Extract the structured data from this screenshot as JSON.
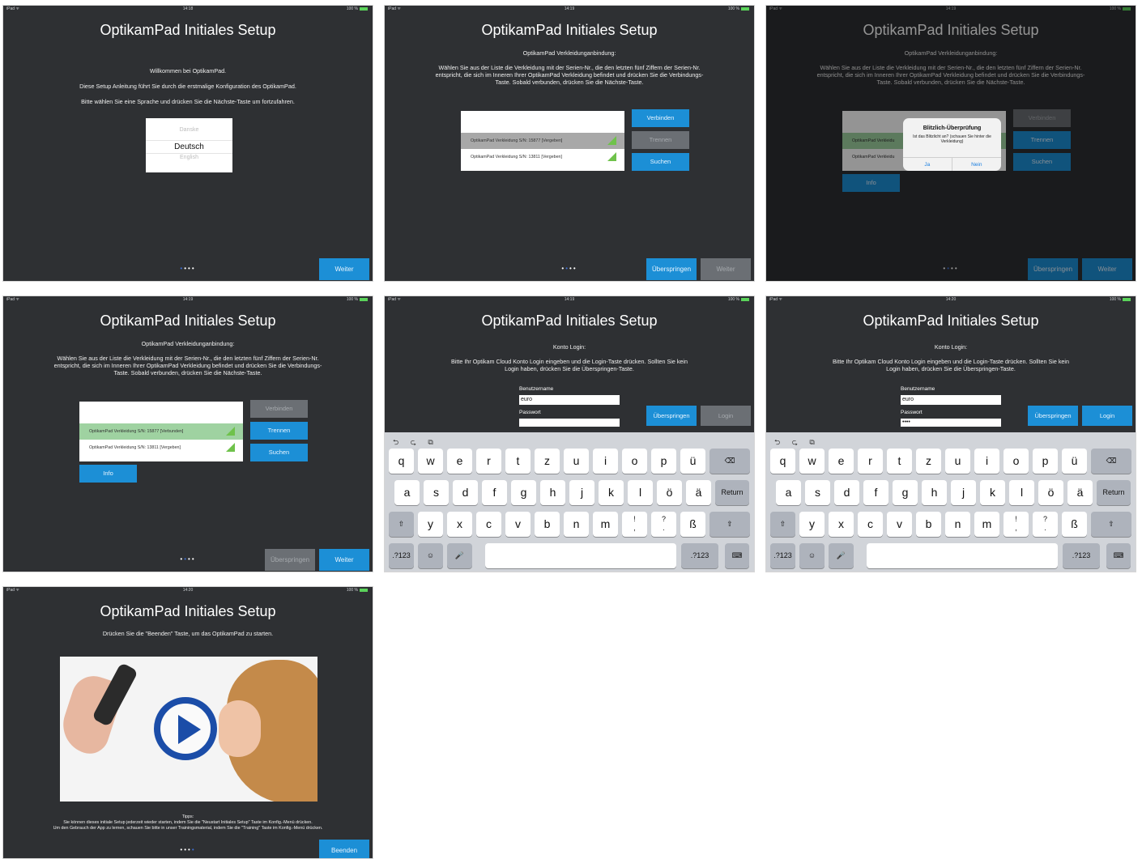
{
  "status": {
    "device": "iPad ᯤ",
    "battery": "100 %",
    "bt": "✱"
  },
  "title": "OptikamPad Initiales Setup",
  "screen1": {
    "time": "14:18",
    "welcome": "Willkommen bei OptikamPad.",
    "guide": "Diese Setup Anleitung führt Sie durch die erstmalige Konfiguration des OptikamPad.",
    "choose": "Bitte wählen Sie eine Sprache und drücken Sie  die Nächste-Taste um fortzufahren.",
    "languages": [
      "Danske",
      "Deutsch",
      "English"
    ],
    "next": "Weiter"
  },
  "pairing": {
    "heading": "OptikamPad Verkleidunganbindung:",
    "instr": "Wählen Sie aus der Liste die Verkleidung mit der Serien-Nr., die den letzten fünf Ziffern der Serien-Nr. entspricht, die sich im Inneren Ihrer OptikamPad Verkleidung befindet und drücken Sie die Verbindungs-Taste. Sobald verbunden, drücken Sie die Nächste-Taste.",
    "connect": "Verbinden",
    "disconnect": "Trennen",
    "search": "Suchen",
    "info": "Info",
    "skip": "Überspringen",
    "next": "Weiter",
    "item1": "OptikamPad Verkleidung S/N: 15877 [Vergeben]",
    "item1_connected": "OptikamPad Verkleidung S/N: 15877 [Verbunden]",
    "item2": "OptikamPad Verkleidung S/N: 13811 [Vergeben]",
    "item_short": "OptikamPad Verkleidu"
  },
  "screen2": {
    "time": "14:19"
  },
  "screen3": {
    "time": "14:19",
    "alert_title": "Blitzlich-Überprüfung",
    "alert_msg": "Ist das Blitzlicht an? (schauen Sie hinter die Verkleidung)",
    "yes": "Ja",
    "no": "Nein"
  },
  "screen4": {
    "time": "14:19"
  },
  "login": {
    "heading": "Konto Login:",
    "instr": "Bitte Ihr Optikam Cloud Konto Login eingeben und die Login-Taste drücken. Sollten Sie kein Login haben, drücken Sie die Überspringen-Taste.",
    "user_label": "Benutzername",
    "pass_label": "Passwort",
    "user_value": "euro",
    "pass_value": "••••",
    "skip": "Überspringen",
    "login": "Login"
  },
  "screen5": {
    "time": "14:19"
  },
  "screen6": {
    "time": "14:20"
  },
  "keyboard": {
    "tools": "⮌ ⮎ ⧉",
    "row1": [
      "q",
      "w",
      "e",
      "r",
      "t",
      "z",
      "u",
      "i",
      "o",
      "p",
      "ü"
    ],
    "row2": [
      "a",
      "s",
      "d",
      "f",
      "g",
      "h",
      "j",
      "k",
      "l",
      "ö",
      "ä"
    ],
    "row3": [
      "y",
      "x",
      "c",
      "v",
      "b",
      "n",
      "m",
      "!\n,",
      "?\n.",
      "ß"
    ],
    "backspace": "⌫",
    "return": "Return",
    "shift": "⇧",
    "num": ".?123",
    "emoji": "☺",
    "mic": "🎤",
    "hide": "⌨"
  },
  "screen7": {
    "time": "14:20",
    "start": "Drücken Sie die \"Beenden\" Taste, um das OptikamPad zu starten.",
    "tips_title": "Tipps:",
    "tip1": "Sie können dieses initiale Setup jederzeit wieder starten, indem Sie die \"Neustart Initiales Setup\" Taste im Konfig.-Menü drücken.",
    "tip2": "Um den Gebrauch der App zu lernen, schauen Sie bitte in unser Trainingsmaterial, indem Sie die \"Training\" Taste im Konfig.-Menü drücken.",
    "finish": "Beenden"
  },
  "dots": {
    "d1": "•",
    "d2": "•",
    "d3": "•",
    "d4": "•"
  },
  "colors": {
    "accent": "#1c8fd6",
    "bg": "#2e3033",
    "connected": "#9fd2a1"
  }
}
